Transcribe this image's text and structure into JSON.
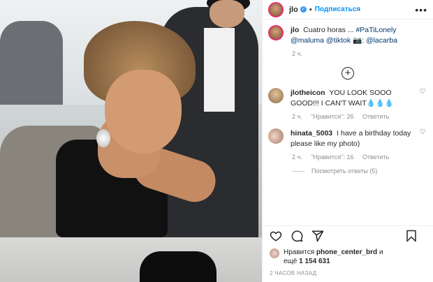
{
  "header": {
    "username": "jlo",
    "follow_label": "Подписаться",
    "more_label": "•••"
  },
  "caption": {
    "username": "jlo",
    "text": "Cuatro horas ... ",
    "hashtag": "#PaTiLonely",
    "mentions": "@maluma @tiktok",
    "credit_prefix": "📷: ",
    "credit_mention": "@lacarba",
    "time": "2 ч."
  },
  "load_more_label": "+",
  "comments": [
    {
      "username": "jlotheicon",
      "text": "YOU LOOK SOOO GOOD!!! I CAN'T WAIT💧💧💧",
      "time": "2 ч.",
      "likes": "\"Нравится\": 26",
      "reply_label": "Ответить"
    },
    {
      "username": "hinata_5003",
      "text": "I have a birthday today please like my photo)",
      "time": "2 ч.",
      "likes": "\"Нравится\": 16",
      "reply_label": "Ответить"
    }
  ],
  "view_replies_label": "Посмотреть ответы (5)",
  "likes": {
    "prefix": "Нравится",
    "user": "phone_center_brd",
    "suffix": "и",
    "others_prefix": "ещё",
    "count": "1 154 631"
  },
  "post_time": "2 ЧАСОВ НАЗАД",
  "icons": {
    "heart": "heart-icon",
    "comment": "comment-icon",
    "share": "share-icon",
    "save": "bookmark-icon"
  },
  "colors": {
    "follow": "#0095f6",
    "verified": "#3897f0",
    "meta": "#8e8e8e"
  }
}
